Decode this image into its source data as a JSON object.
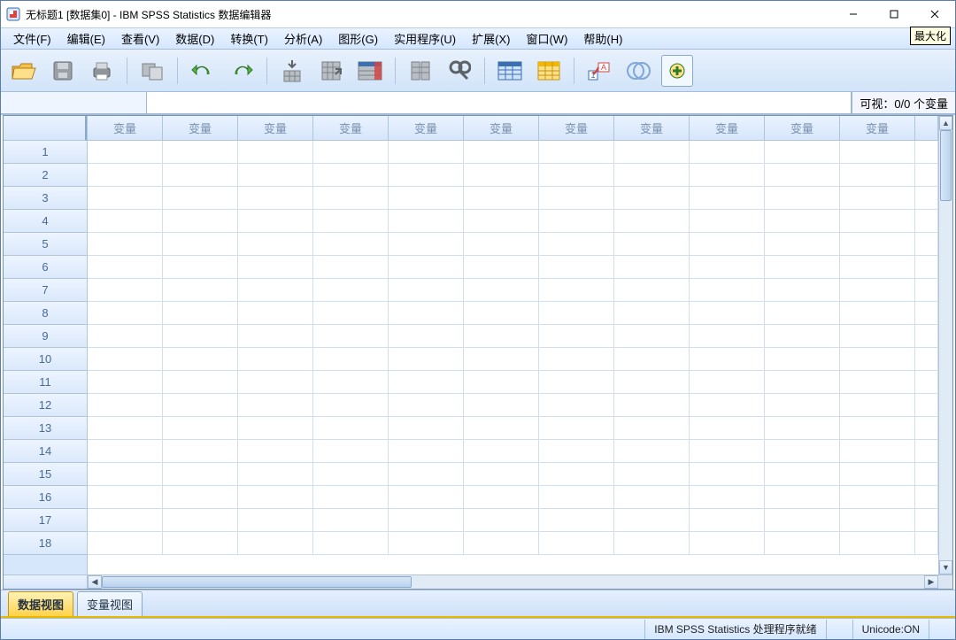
{
  "window": {
    "title": "无标题1 [数据集0] - IBM SPSS Statistics 数据编辑器",
    "tooltip_maximize": "最大化"
  },
  "menu": {
    "file": "文件(F)",
    "edit": "编辑(E)",
    "view": "查看(V)",
    "data": "数据(D)",
    "transform": "转换(T)",
    "analyze": "分析(A)",
    "graphs": "图形(G)",
    "utilities": "实用程序(U)",
    "extensions": "扩展(X)",
    "window": "窗口(W)",
    "help": "帮助(H)"
  },
  "namebar": {
    "goto_value": "",
    "visible_label": "可视：0/0 个变量"
  },
  "grid": {
    "col_header_label": "变量",
    "num_cols": 11,
    "row_headers": [
      1,
      2,
      3,
      4,
      5,
      6,
      7,
      8,
      9,
      10,
      11,
      12,
      13,
      14,
      15,
      16,
      17,
      18
    ]
  },
  "tabs": {
    "data_view": "数据视图",
    "variable_view": "变量视图"
  },
  "status": {
    "processor": "IBM SPSS Statistics 处理程序就绪",
    "unicode": "Unicode:ON"
  },
  "icons": {
    "open": "open-folder",
    "save": "save",
    "print": "print",
    "recall": "recall-dialog",
    "undo": "undo",
    "redo": "redo",
    "gotocase": "goto-case",
    "gotovar": "goto-variable",
    "variables": "variables",
    "run": "run-pending",
    "find": "find",
    "splitfile": "split-file",
    "weight": "weight-cases",
    "selectcases": "select-cases",
    "valuelabels": "value-labels",
    "usesets": "use-sets",
    "addon": "addon"
  }
}
